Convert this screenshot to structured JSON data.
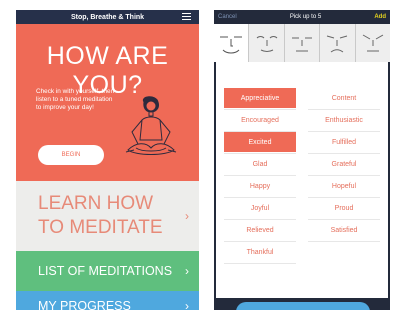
{
  "left": {
    "header_title": "Stop, Breathe & Think",
    "hero_title": "HOW ARE YOU?",
    "hero_text": "Check in with yourself, then listen to a tuned meditation to improve your day!",
    "begin_label": "BEGIN",
    "menu": [
      {
        "line1": "LEARN HOW",
        "line2": "TO MEDITATE"
      },
      {
        "label": "LIST OF MEDITATIONS"
      },
      {
        "label": "MY PROGRESS"
      }
    ],
    "chevron": "›"
  },
  "right": {
    "cancel_label": "Cancel",
    "title": "Pick up to 5",
    "add_label": "Add",
    "faces": [
      "smile-face",
      "content-face",
      "neutral-face",
      "sad-face",
      "angry-face"
    ],
    "emotions_left": [
      {
        "label": "Appreciative",
        "selected": true
      },
      {
        "label": "Encouraged",
        "selected": false
      },
      {
        "label": "Excited",
        "selected": true
      },
      {
        "label": "Glad",
        "selected": false
      },
      {
        "label": "Happy",
        "selected": false
      },
      {
        "label": "Joyful",
        "selected": false
      },
      {
        "label": "Relieved",
        "selected": false
      },
      {
        "label": "Thankful",
        "selected": false
      }
    ],
    "emotions_right": [
      {
        "label": "Content",
        "selected": false
      },
      {
        "label": "Enthusiastic",
        "selected": false
      },
      {
        "label": "Fulfilled",
        "selected": false
      },
      {
        "label": "Grateful",
        "selected": false
      },
      {
        "label": "Hopeful",
        "selected": false
      },
      {
        "label": "Proud",
        "selected": false
      },
      {
        "label": "Satisfied",
        "selected": false
      }
    ]
  },
  "colors": {
    "coral": "#ef6a56",
    "green": "#5fbf7e",
    "blue": "#4fa8de",
    "navy": "#232a3b",
    "yellow": "#e5d31f"
  }
}
